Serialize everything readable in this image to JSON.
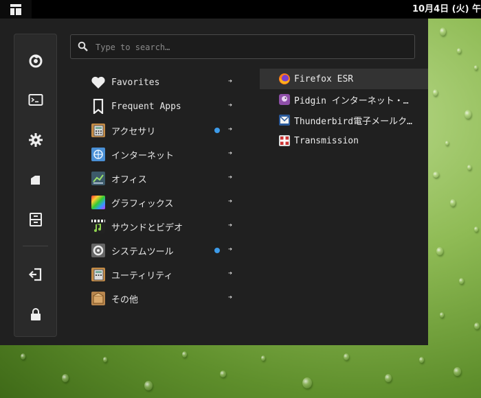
{
  "topbar": {
    "clock": "10月4日 (火) 午"
  },
  "search": {
    "placeholder": "Type to search…",
    "value": ""
  },
  "sidebar": {
    "items": [
      "firefox-icon",
      "terminal-icon",
      "settings-icon",
      "files-icon",
      "archive-icon",
      "logout-icon",
      "lock-icon"
    ]
  },
  "categories": [
    {
      "label": "Favorites",
      "icon": "heart-icon",
      "badge": false
    },
    {
      "label": "Frequent Apps",
      "icon": "bookmark-icon",
      "badge": false
    },
    {
      "label": "アクセサリ",
      "icon": "accessories-icon",
      "badge": true
    },
    {
      "label": "インターネット",
      "icon": "internet-icon",
      "badge": false
    },
    {
      "label": "オフィス",
      "icon": "office-icon",
      "badge": false
    },
    {
      "label": "グラフィックス",
      "icon": "graphics-icon",
      "badge": false
    },
    {
      "label": "サウンドとビデオ",
      "icon": "multimedia-icon",
      "badge": false
    },
    {
      "label": "システムツール",
      "icon": "system-tools-icon",
      "badge": true
    },
    {
      "label": "ユーティリティ",
      "icon": "utilities-icon",
      "badge": false
    },
    {
      "label": "その他",
      "icon": "other-icon",
      "badge": false
    }
  ],
  "apps": [
    {
      "label": "Firefox ESR",
      "icon": "firefox-icon",
      "selected": true
    },
    {
      "label": "Pidgin インターネット・…",
      "icon": "pidgin-icon",
      "selected": false
    },
    {
      "label": "Thunderbird電子メールク…",
      "icon": "thunderbird-icon",
      "selected": false
    },
    {
      "label": "Transmission",
      "icon": "transmission-icon",
      "selected": false
    }
  ],
  "colors": {
    "menu_bg": "#202020",
    "selection": "#333333",
    "badge": "#3d9be9",
    "desktop": "#8fbb55"
  }
}
